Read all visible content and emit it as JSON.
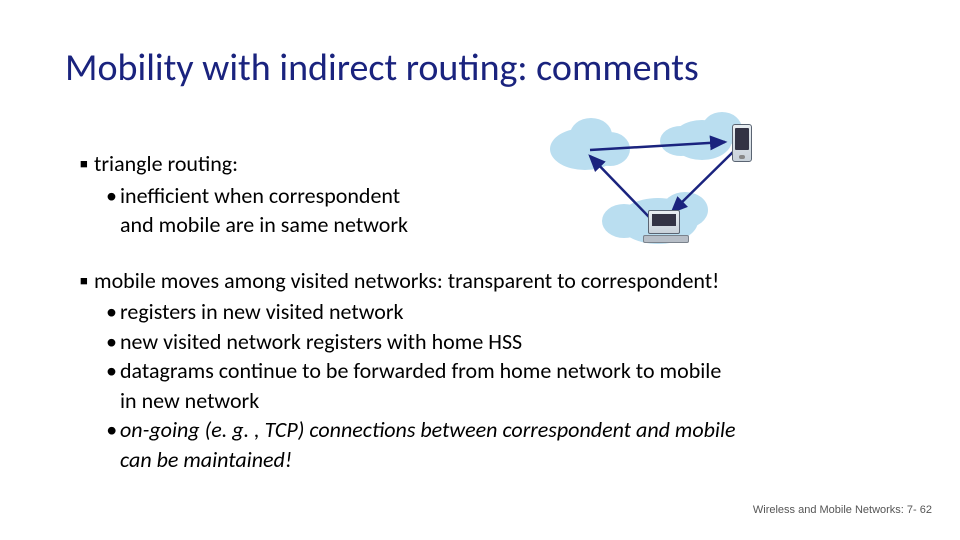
{
  "title": "Mobility with indirect routing: comments",
  "block1": {
    "heading": "triangle routing:",
    "sub1a": "inefficient when correspondent",
    "sub1b": "and mobile are in same network"
  },
  "block2": {
    "heading": "mobile moves among visited networks: transparent to correspondent!",
    "sub1": "registers in new visited network",
    "sub2": "new visited network registers with home HSS",
    "sub3a": "datagrams continue to be forwarded from home network to mobile",
    "sub3b": "in new network",
    "sub4a": "on-going (e. g. , TCP) connections between correspondent and mobile",
    "sub4b": "can be maintained!"
  },
  "footer": "Wireless and Mobile Networks: 7- 62"
}
